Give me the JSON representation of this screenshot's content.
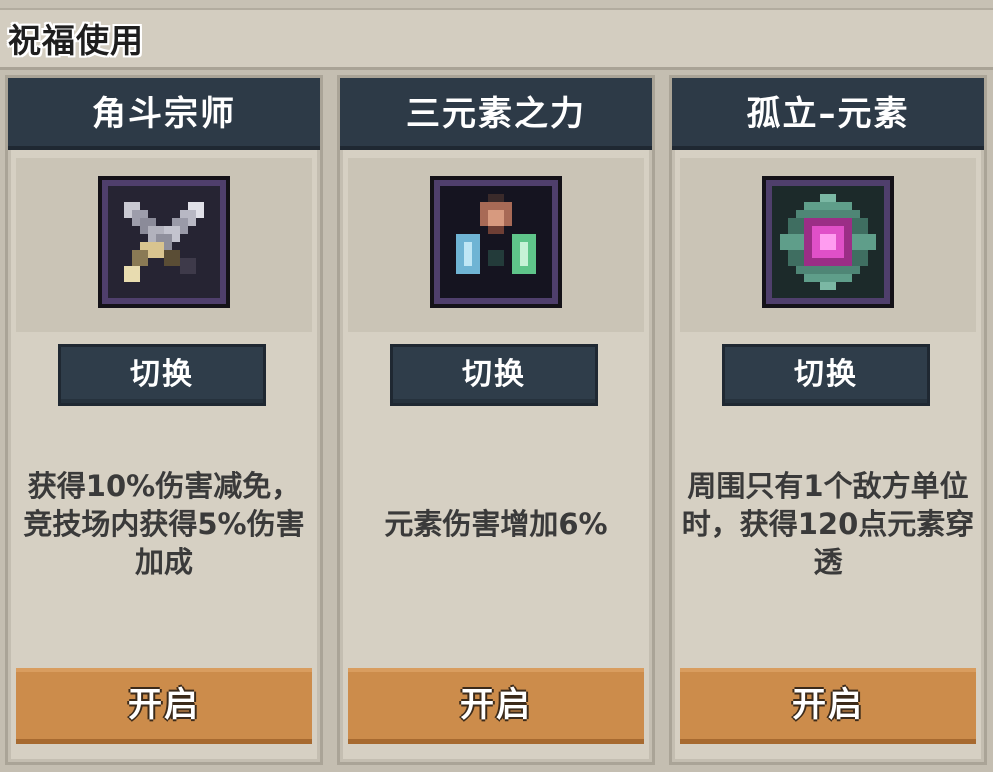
{
  "header": {
    "title": "祝福使用"
  },
  "cards": [
    {
      "title": "角斗宗师",
      "icon": "crossed-swords-icon",
      "switch_label": "切换",
      "description": "获得10%伤害减免，竞技场内获得5%伤害加成",
      "open_label": "开启"
    },
    {
      "title": "三元素之力",
      "icon": "three-elements-gems-icon",
      "switch_label": "切换",
      "description": "元素伤害增加6%",
      "open_label": "开启"
    },
    {
      "title": "孤立–元素",
      "icon": "isolated-element-crystal-icon",
      "switch_label": "切换",
      "description": "周围只有1个敌方单位时，获得120点元素穿透",
      "open_label": "开启"
    }
  ],
  "colors": {
    "header_bg": "#2d3a47",
    "button_dark": "#2f3d4a",
    "button_orange": "#cc8c4b",
    "panel_bg": "#d6d0c3",
    "icon_frame": "#4f3f6c"
  }
}
